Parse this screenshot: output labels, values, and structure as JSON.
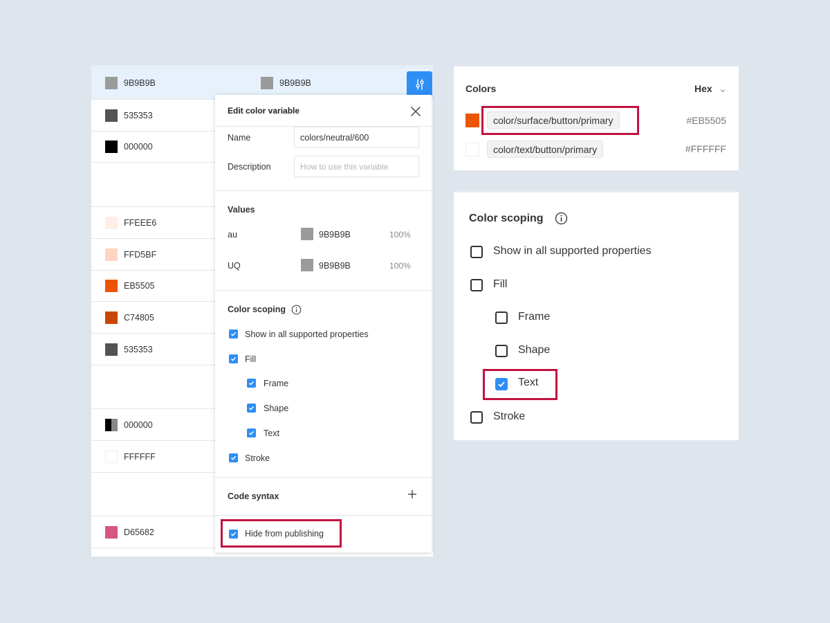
{
  "table": {
    "rows": [
      {
        "c1": {
          "hex": "9B9B9B",
          "color": "#9b9b9b"
        },
        "c2": {
          "hex": "9B9B9B",
          "color": "#9b9b9b"
        }
      },
      {
        "c1": {
          "hex": "535353",
          "color": "#535353"
        }
      },
      {
        "c1": {
          "hex": "000000",
          "color": "#000000"
        }
      },
      {
        "c1": {
          "hex": "FFEEE6",
          "color": "#ffeee6"
        }
      },
      {
        "c1": {
          "hex": "FFD5BF",
          "color": "#ffd5bf"
        }
      },
      {
        "c1": {
          "hex": "EB5505",
          "color": "#eb5505"
        }
      },
      {
        "c1": {
          "hex": "C74805",
          "color": "#c74805"
        }
      },
      {
        "c1": {
          "hex": "535353",
          "color": "#535353"
        }
      },
      {
        "c1": {
          "hex": "000000",
          "color": "#000000"
        }
      },
      {
        "c1": {
          "hex": "FFFFFF",
          "color": "#ffffff"
        }
      },
      {
        "c1": {
          "hex": "D65682",
          "color": "#d65682"
        }
      }
    ],
    "settings_icon": "sliders-icon"
  },
  "edit_panel": {
    "title": "Edit color variable",
    "name_label": "Name",
    "name_value": "colors/neutral/600",
    "description_label": "Description",
    "description_placeholder": "How to use this variable",
    "values_title": "Values",
    "values": [
      {
        "mode": "au",
        "hex": "9B9B9B",
        "color": "#9b9b9b",
        "opacity": "100%"
      },
      {
        "mode": "UQ",
        "hex": "9B9B9B",
        "color": "#9b9b9b",
        "opacity": "100%"
      }
    ],
    "scoping_title": "Color scoping",
    "scoping": [
      {
        "label": "Show in all supported properties",
        "checked": true
      },
      {
        "label": "Fill",
        "checked": true
      },
      {
        "label": "Frame",
        "checked": true
      },
      {
        "label": "Shape",
        "checked": true
      },
      {
        "label": "Text",
        "checked": true
      },
      {
        "label": "Stroke",
        "checked": true
      }
    ],
    "code_syntax_title": "Code syntax",
    "hide_label": "Hide from publishing"
  },
  "colors_panel": {
    "title": "Colors",
    "format": "Hex",
    "items": [
      {
        "name": "color/surface/button/primary",
        "hex": "#EB5505",
        "color": "#eb5505"
      },
      {
        "name": "color/text/button/primary",
        "hex": "#FFFFFF",
        "color": "#ffffff"
      }
    ]
  },
  "scoping_panel": {
    "title": "Color scoping",
    "options": [
      {
        "label": "Show in all supported properties",
        "checked": false
      },
      {
        "label": "Fill",
        "checked": false
      },
      {
        "label": "Frame",
        "checked": false
      },
      {
        "label": "Shape",
        "checked": false
      },
      {
        "label": "Text",
        "checked": true
      },
      {
        "label": "Stroke",
        "checked": false
      }
    ]
  },
  "accent": "#2f8ef4",
  "highlight": "#c1123f"
}
